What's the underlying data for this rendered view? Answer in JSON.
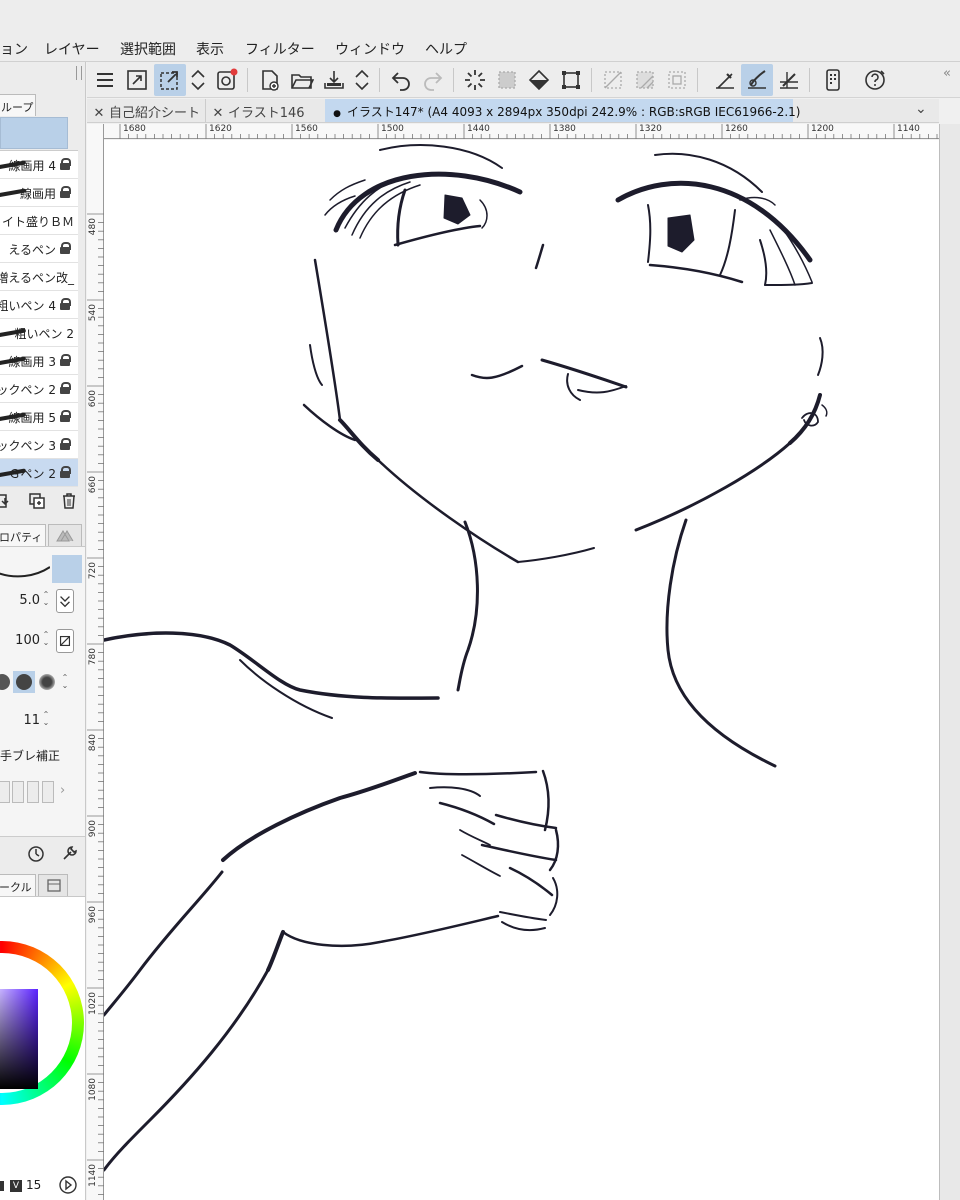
{
  "menu": {
    "items": [
      "ョン",
      "レイヤー",
      "選択範囲",
      "表示",
      "フィルター",
      "ウィンドウ",
      "ヘルプ"
    ]
  },
  "left_panel": {
    "group_tab_label": "ループ",
    "sub_tools": [
      {
        "label": "線画用 4",
        "locked": true,
        "selected": false
      },
      {
        "label": "線画用",
        "locked": true,
        "selected": false
      },
      {
        "label": "イト盛りＢＭ",
        "locked": false,
        "selected": false
      },
      {
        "label": "えるペン",
        "locked": true,
        "selected": false
      },
      {
        "label": "増えるペン改_",
        "locked": false,
        "selected": false
      },
      {
        "label": "粗いペン 4",
        "locked": true,
        "selected": false
      },
      {
        "label": "粗いペン 2",
        "locked": false,
        "selected": false
      },
      {
        "label": "線画用 3",
        "locked": true,
        "selected": false
      },
      {
        "label": "ックペン 2",
        "locked": true,
        "selected": false
      },
      {
        "label": "線画用 5",
        "locked": true,
        "selected": false
      },
      {
        "label": "ックペン 3",
        "locked": true,
        "selected": false
      },
      {
        "label": "Ｇペン 2",
        "locked": true,
        "selected": true
      }
    ],
    "property_tab_label": "ロパティ",
    "brush_size": "5.0",
    "opacity": "100",
    "stabilization": "11",
    "stabilization_label": "手ブレ補正",
    "circle_tab_label": "ークル",
    "color_footer": {
      "v_label": "V",
      "value": "15"
    }
  },
  "toolbar": {
    "icons": [
      "menu-icon",
      "expand-icon",
      "selection-link-icon",
      "updown-icon",
      "save-icon",
      "new-document-icon",
      "open-icon",
      "export-icon",
      "updown2-icon",
      "undo-icon",
      "redo-icon",
      "spinner-icon",
      "deselect-icon",
      "fill-icon",
      "transform-icon",
      "grid-icon",
      "hatch-icon",
      "frame-icon",
      "ruler-snap-icon",
      "brush-snap-icon",
      "perspective-snap-icon",
      "device-icon",
      "help-icon"
    ]
  },
  "doc_tabs": [
    {
      "label": "自己紹介シート",
      "active": false
    },
    {
      "label": "イラスト146",
      "active": false
    },
    {
      "label": "イラスト147* (A4 4093 x 2894px 350dpi 242.9% : RGB:sRGB IEC61966-2.1)",
      "active": true
    }
  ],
  "ruler": {
    "top_labels": [
      "1680",
      "1620",
      "1560",
      "1500",
      "1440",
      "1380",
      "1320",
      "1260",
      "1200",
      "1140"
    ],
    "left_labels": [
      "480",
      "540",
      "600",
      "660",
      "720",
      "780",
      "840",
      "900",
      "960",
      "1020",
      "1080",
      "1140"
    ]
  },
  "colors": {
    "accent": "#b9d0e8",
    "ink": "#1d1c2c",
    "canvas": "#ffffff"
  }
}
